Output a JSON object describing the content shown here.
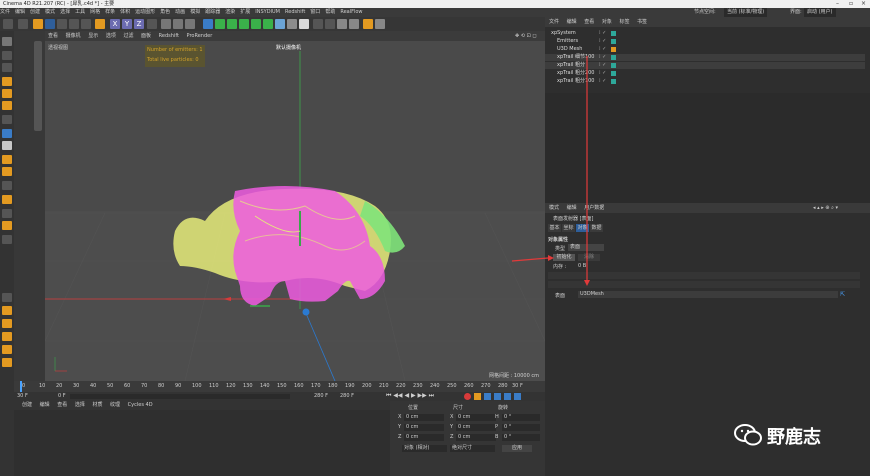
{
  "window": {
    "title": "Cinema 4D R21.207 (RC) - [犀乳.c4d *] - 主要"
  },
  "menubar": {
    "items": [
      "文件",
      "编辑",
      "创建",
      "模式",
      "选择",
      "工具",
      "网格",
      "样条",
      "体积",
      "运动图形",
      "角色",
      "动画",
      "模拟",
      "跟踪器",
      "渲染",
      "扩展",
      "INSYDIUM",
      "Redshift",
      "窗口",
      "帮助",
      "RealFlow"
    ],
    "interface_label": "节点空间:",
    "interface_value": "当前 (标准/物理)",
    "layout_label": "界面:",
    "layout_value": "启动 (用户)"
  },
  "viewport": {
    "menu": [
      "查看",
      "摄像机",
      "显示",
      "选项",
      "过滤",
      "面板",
      "Redshift",
      "ProRender"
    ],
    "view_name": "透视视图",
    "camera_name": "默认摄像机",
    "hud": {
      "emitters": "Number of emitters: 1",
      "particles": "Total live particles: 0"
    },
    "grid_spacing": "网格间距 : 10000 cm"
  },
  "timeline": {
    "ticks": [
      "0",
      "10",
      "20",
      "30",
      "40",
      "50",
      "60",
      "70",
      "80",
      "90",
      "100",
      "110",
      "120",
      "130",
      "140",
      "150",
      "160",
      "170",
      "180",
      "190",
      "200",
      "210",
      "220",
      "230",
      "240",
      "250",
      "260",
      "270",
      "280"
    ],
    "current_frame": "30 F",
    "start_frame": "30 F",
    "min_frame": "0 F",
    "end_frame": "280 F",
    "max_frame": "280 F"
  },
  "material_menu": [
    "创建",
    "编辑",
    "查看",
    "选择",
    "材质",
    "纹理",
    "Cycles 4D"
  ],
  "coords": {
    "headers": {
      "position": "位置",
      "size": "尺寸",
      "rotation": "旋转"
    },
    "rows": [
      {
        "axis": "X",
        "pos": "0 cm",
        "size": "0 cm",
        "rot_label": "H",
        "rot": "0 °"
      },
      {
        "axis": "Y",
        "pos": "0 cm",
        "size": "0 cm",
        "rot_label": "P",
        "rot": "0 °"
      },
      {
        "axis": "Z",
        "pos": "0 cm",
        "size": "0 cm",
        "rot_label": "B",
        "rot": "0 °"
      }
    ],
    "mode_dropdown": "对象 (相对)",
    "size_dropdown": "绝对尺寸",
    "apply_button": "应用"
  },
  "object_manager": {
    "menu": [
      "文件",
      "编辑",
      "查看",
      "对象",
      "标签",
      "书签"
    ],
    "objects": [
      {
        "name": "xpSystem",
        "indent": 0
      },
      {
        "name": "Emitters",
        "indent": 1
      },
      {
        "name": "U3D Mesh",
        "indent": 1
      },
      {
        "name": "xpTrail 细节100",
        "indent": 1
      },
      {
        "name": "xpTrail 粗分",
        "indent": 1
      },
      {
        "name": "xpTrail 粗分200",
        "indent": 1
      },
      {
        "name": "xpTrail 粗分100",
        "indent": 1
      }
    ]
  },
  "attributes": {
    "menu": [
      "模式",
      "编辑",
      "用户数据"
    ],
    "object_label": "表面发射器 [表面]",
    "tabs": [
      "基本",
      "坐标",
      "对象",
      "数据"
    ],
    "active_tab": "对象",
    "section": "对象属性",
    "type_label": "类型",
    "type_value": "表面",
    "init_button": "初始化",
    "clear_button": "清除",
    "memory_label": "内存 :",
    "memory_value": "0 B",
    "mesh_label": "表面",
    "mesh_value": "U3DMesh"
  },
  "watermark": {
    "text": "野鹿志"
  },
  "colors": {
    "accent_orange": "#e39a21",
    "hud_text": "#d2a12a",
    "hud_bg": "#5a5430",
    "particle_yellow": "#e6ec7a",
    "particle_pink": "#ee5ce0",
    "particle_green": "#7fe37a",
    "axis_red": "#d83a3a",
    "axis_green": "#3aa84a",
    "axis_blue": "#2b7ad1",
    "highlight_blue": "#2e5e9a"
  }
}
